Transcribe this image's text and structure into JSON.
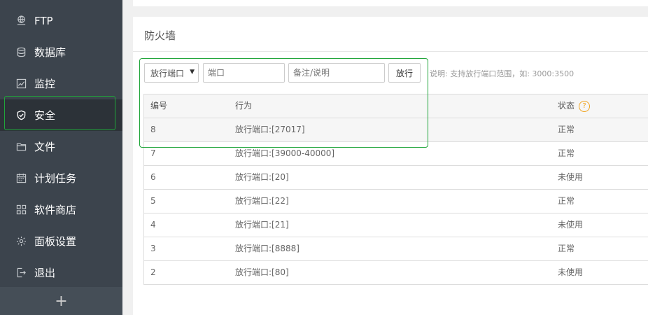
{
  "sidebar": {
    "items": [
      {
        "label": "FTP",
        "icon": "ftp-icon"
      },
      {
        "label": "数据库",
        "icon": "database-icon"
      },
      {
        "label": "监控",
        "icon": "monitor-icon"
      },
      {
        "label": "安全",
        "icon": "shield-icon"
      },
      {
        "label": "文件",
        "icon": "folder-icon"
      },
      {
        "label": "计划任务",
        "icon": "calendar-icon"
      },
      {
        "label": "软件商店",
        "icon": "apps-icon"
      },
      {
        "label": "面板设置",
        "icon": "gear-icon"
      },
      {
        "label": "退出",
        "icon": "logout-icon"
      }
    ],
    "active_index": 3,
    "plus_label": "+"
  },
  "firewall": {
    "title": "防火墙",
    "select_value": "放行端口",
    "select_arrow": "▼",
    "port_placeholder": "端口",
    "note_placeholder": "备注/说明",
    "submit_label": "放行",
    "hint": "说明: 支持放行端口范围，如: 3000:3500"
  },
  "table": {
    "headers": {
      "id": "编号",
      "action": "行为",
      "status": "状态",
      "help": "?"
    },
    "rows": [
      {
        "id": "8",
        "action": "放行端口:[27017]",
        "status": "正常"
      },
      {
        "id": "7",
        "action": "放行端口:[39000-40000]",
        "status": "正常"
      },
      {
        "id": "6",
        "action": "放行端口:[20]",
        "status": "未使用"
      },
      {
        "id": "5",
        "action": "放行端口:[22]",
        "status": "正常"
      },
      {
        "id": "4",
        "action": "放行端口:[21]",
        "status": "未使用"
      },
      {
        "id": "3",
        "action": "放行端口:[8888]",
        "status": "正常"
      },
      {
        "id": "2",
        "action": "放行端口:[80]",
        "status": "未使用"
      }
    ]
  },
  "colors": {
    "accent": "#20a53a",
    "sidebar": "#3c444d",
    "help": "#f0a31e"
  }
}
